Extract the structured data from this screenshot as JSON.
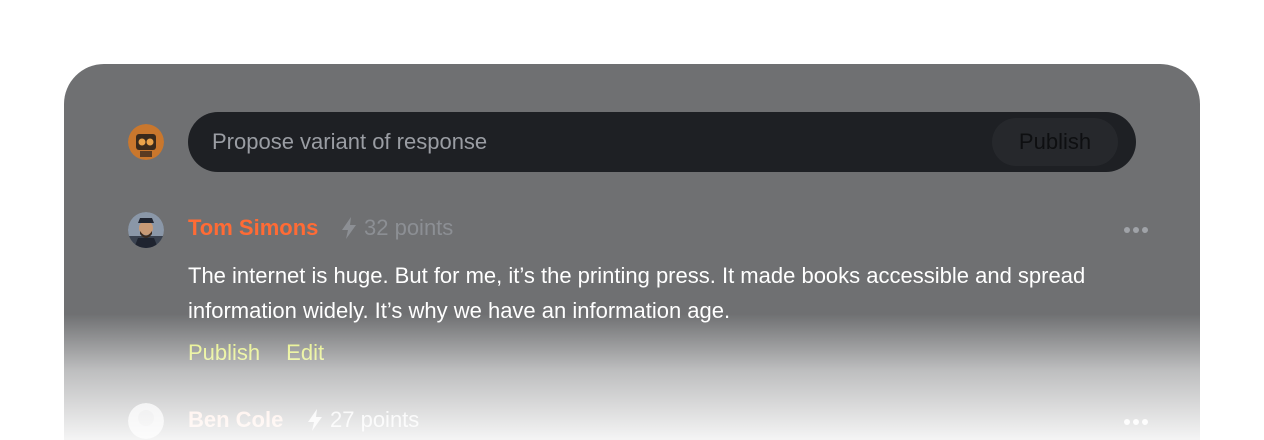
{
  "composer": {
    "placeholder": "Propose variant of response",
    "value": "",
    "publish_label": "Publish"
  },
  "comments": [
    {
      "author": "Tom Simons",
      "points": "32 points",
      "text": "The internet is huge. But for me, it’s the printing press. It made books accessible and spread information widely. It’s why we have an information age.",
      "actions": [
        "Publish",
        "Edit"
      ]
    },
    {
      "author": "Ben Cole",
      "points": "27 points"
    }
  ],
  "colors": {
    "panel": "#6f7072",
    "composer": "#1e2024",
    "author": "#ff6b35",
    "action": "#e3ef72"
  },
  "icons": {
    "points": "lightning-bolt-icon",
    "more": "more-dots-icon"
  }
}
